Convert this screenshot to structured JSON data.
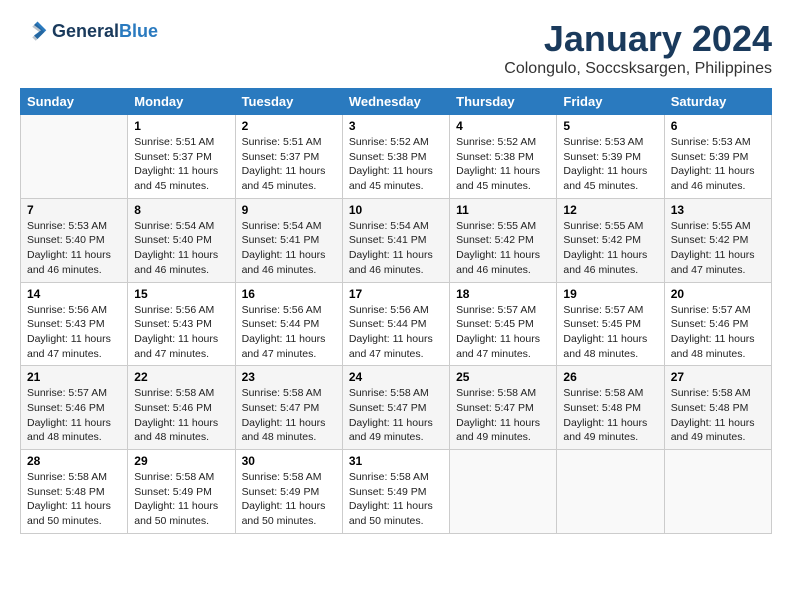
{
  "logo": {
    "line1": "General",
    "line2": "Blue"
  },
  "title": "January 2024",
  "subtitle": "Colongulo, Soccsksargen, Philippines",
  "days_header": [
    "Sunday",
    "Monday",
    "Tuesday",
    "Wednesday",
    "Thursday",
    "Friday",
    "Saturday"
  ],
  "weeks": [
    [
      {
        "num": "",
        "info": ""
      },
      {
        "num": "1",
        "info": "Sunrise: 5:51 AM\nSunset: 5:37 PM\nDaylight: 11 hours\nand 45 minutes."
      },
      {
        "num": "2",
        "info": "Sunrise: 5:51 AM\nSunset: 5:37 PM\nDaylight: 11 hours\nand 45 minutes."
      },
      {
        "num": "3",
        "info": "Sunrise: 5:52 AM\nSunset: 5:38 PM\nDaylight: 11 hours\nand 45 minutes."
      },
      {
        "num": "4",
        "info": "Sunrise: 5:52 AM\nSunset: 5:38 PM\nDaylight: 11 hours\nand 45 minutes."
      },
      {
        "num": "5",
        "info": "Sunrise: 5:53 AM\nSunset: 5:39 PM\nDaylight: 11 hours\nand 45 minutes."
      },
      {
        "num": "6",
        "info": "Sunrise: 5:53 AM\nSunset: 5:39 PM\nDaylight: 11 hours\nand 46 minutes."
      }
    ],
    [
      {
        "num": "7",
        "info": "Sunrise: 5:53 AM\nSunset: 5:40 PM\nDaylight: 11 hours\nand 46 minutes."
      },
      {
        "num": "8",
        "info": "Sunrise: 5:54 AM\nSunset: 5:40 PM\nDaylight: 11 hours\nand 46 minutes."
      },
      {
        "num": "9",
        "info": "Sunrise: 5:54 AM\nSunset: 5:41 PM\nDaylight: 11 hours\nand 46 minutes."
      },
      {
        "num": "10",
        "info": "Sunrise: 5:54 AM\nSunset: 5:41 PM\nDaylight: 11 hours\nand 46 minutes."
      },
      {
        "num": "11",
        "info": "Sunrise: 5:55 AM\nSunset: 5:42 PM\nDaylight: 11 hours\nand 46 minutes."
      },
      {
        "num": "12",
        "info": "Sunrise: 5:55 AM\nSunset: 5:42 PM\nDaylight: 11 hours\nand 46 minutes."
      },
      {
        "num": "13",
        "info": "Sunrise: 5:55 AM\nSunset: 5:42 PM\nDaylight: 11 hours\nand 47 minutes."
      }
    ],
    [
      {
        "num": "14",
        "info": "Sunrise: 5:56 AM\nSunset: 5:43 PM\nDaylight: 11 hours\nand 47 minutes."
      },
      {
        "num": "15",
        "info": "Sunrise: 5:56 AM\nSunset: 5:43 PM\nDaylight: 11 hours\nand 47 minutes."
      },
      {
        "num": "16",
        "info": "Sunrise: 5:56 AM\nSunset: 5:44 PM\nDaylight: 11 hours\nand 47 minutes."
      },
      {
        "num": "17",
        "info": "Sunrise: 5:56 AM\nSunset: 5:44 PM\nDaylight: 11 hours\nand 47 minutes."
      },
      {
        "num": "18",
        "info": "Sunrise: 5:57 AM\nSunset: 5:45 PM\nDaylight: 11 hours\nand 47 minutes."
      },
      {
        "num": "19",
        "info": "Sunrise: 5:57 AM\nSunset: 5:45 PM\nDaylight: 11 hours\nand 48 minutes."
      },
      {
        "num": "20",
        "info": "Sunrise: 5:57 AM\nSunset: 5:46 PM\nDaylight: 11 hours\nand 48 minutes."
      }
    ],
    [
      {
        "num": "21",
        "info": "Sunrise: 5:57 AM\nSunset: 5:46 PM\nDaylight: 11 hours\nand 48 minutes."
      },
      {
        "num": "22",
        "info": "Sunrise: 5:58 AM\nSunset: 5:46 PM\nDaylight: 11 hours\nand 48 minutes."
      },
      {
        "num": "23",
        "info": "Sunrise: 5:58 AM\nSunset: 5:47 PM\nDaylight: 11 hours\nand 48 minutes."
      },
      {
        "num": "24",
        "info": "Sunrise: 5:58 AM\nSunset: 5:47 PM\nDaylight: 11 hours\nand 49 minutes."
      },
      {
        "num": "25",
        "info": "Sunrise: 5:58 AM\nSunset: 5:47 PM\nDaylight: 11 hours\nand 49 minutes."
      },
      {
        "num": "26",
        "info": "Sunrise: 5:58 AM\nSunset: 5:48 PM\nDaylight: 11 hours\nand 49 minutes."
      },
      {
        "num": "27",
        "info": "Sunrise: 5:58 AM\nSunset: 5:48 PM\nDaylight: 11 hours\nand 49 minutes."
      }
    ],
    [
      {
        "num": "28",
        "info": "Sunrise: 5:58 AM\nSunset: 5:48 PM\nDaylight: 11 hours\nand 50 minutes."
      },
      {
        "num": "29",
        "info": "Sunrise: 5:58 AM\nSunset: 5:49 PM\nDaylight: 11 hours\nand 50 minutes."
      },
      {
        "num": "30",
        "info": "Sunrise: 5:58 AM\nSunset: 5:49 PM\nDaylight: 11 hours\nand 50 minutes."
      },
      {
        "num": "31",
        "info": "Sunrise: 5:58 AM\nSunset: 5:49 PM\nDaylight: 11 hours\nand 50 minutes."
      },
      {
        "num": "",
        "info": ""
      },
      {
        "num": "",
        "info": ""
      },
      {
        "num": "",
        "info": ""
      }
    ]
  ]
}
